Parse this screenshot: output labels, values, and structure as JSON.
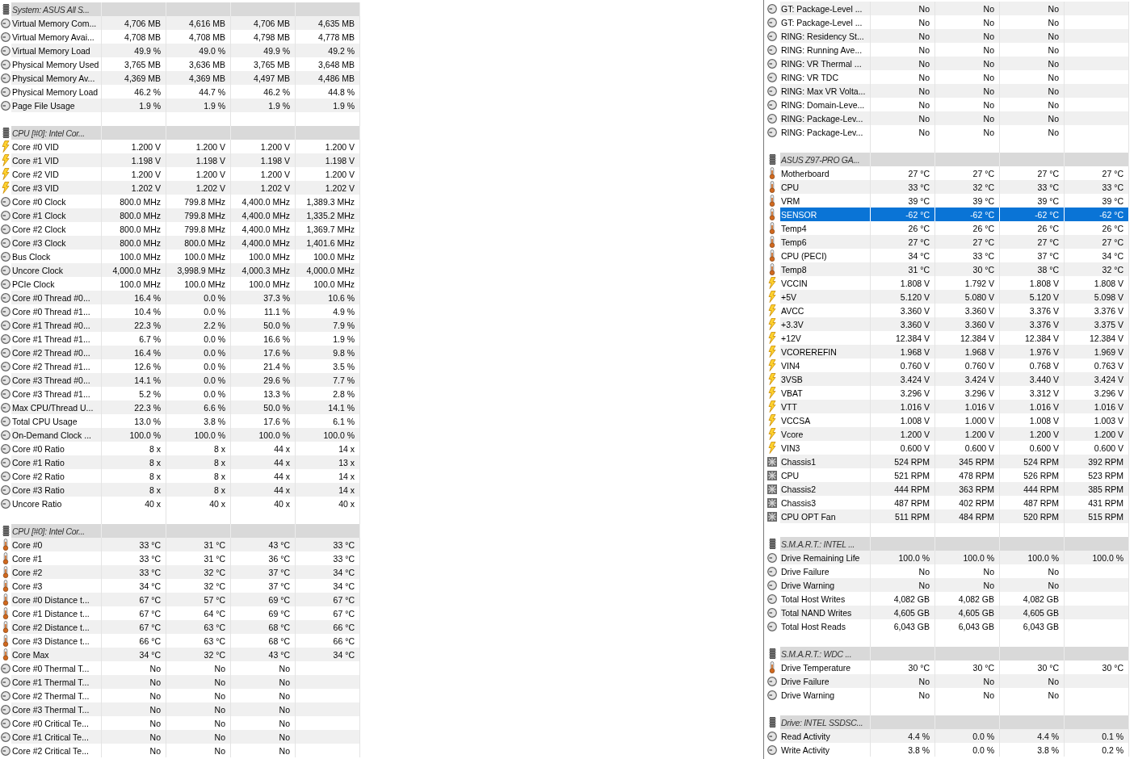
{
  "panels": [
    {
      "groups": [
        {
          "title": "System: ASUS All S...",
          "rows": [
            {
              "kind": "gauge",
              "name": "Virtual Memory Com...",
              "values": [
                "4,706 MB",
                "4,616 MB",
                "4,706 MB",
                "4,635 MB"
              ],
              "selected": false
            },
            {
              "kind": "gauge",
              "name": "Virtual Memory Avai...",
              "values": [
                "4,708 MB",
                "4,708 MB",
                "4,798 MB",
                "4,778 MB"
              ],
              "selected": false
            },
            {
              "kind": "gauge",
              "name": "Virtual Memory Load",
              "values": [
                "49.9 %",
                "49.0 %",
                "49.9 %",
                "49.2 %"
              ],
              "selected": false
            },
            {
              "kind": "gauge",
              "name": "Physical Memory Used",
              "values": [
                "3,765 MB",
                "3,636 MB",
                "3,765 MB",
                "3,648 MB"
              ],
              "selected": false
            },
            {
              "kind": "gauge",
              "name": "Physical Memory Av...",
              "values": [
                "4,369 MB",
                "4,369 MB",
                "4,497 MB",
                "4,486 MB"
              ],
              "selected": false
            },
            {
              "kind": "gauge",
              "name": "Physical Memory Load",
              "values": [
                "46.2 %",
                "44.7 %",
                "46.2 %",
                "44.8 %"
              ],
              "selected": false
            },
            {
              "kind": "gauge",
              "name": "Page File Usage",
              "values": [
                "1.9 %",
                "1.9 %",
                "1.9 %",
                "1.9 %"
              ],
              "selected": false
            }
          ]
        },
        {
          "title": "CPU [#0]: Intel Cor...",
          "rows": [
            {
              "kind": "voltage",
              "name": "Core #0 VID",
              "values": [
                "1.200 V",
                "1.200 V",
                "1.200 V",
                "1.200 V"
              ],
              "selected": false
            },
            {
              "kind": "voltage",
              "name": "Core #1 VID",
              "values": [
                "1.198 V",
                "1.198 V",
                "1.198 V",
                "1.198 V"
              ],
              "selected": false
            },
            {
              "kind": "voltage",
              "name": "Core #2 VID",
              "values": [
                "1.200 V",
                "1.200 V",
                "1.200 V",
                "1.200 V"
              ],
              "selected": false
            },
            {
              "kind": "voltage",
              "name": "Core #3 VID",
              "values": [
                "1.202 V",
                "1.202 V",
                "1.202 V",
                "1.202 V"
              ],
              "selected": false
            },
            {
              "kind": "gauge",
              "name": "Core #0 Clock",
              "values": [
                "800.0 MHz",
                "799.8 MHz",
                "4,400.0 MHz",
                "1,389.3 MHz"
              ],
              "selected": false
            },
            {
              "kind": "gauge",
              "name": "Core #1 Clock",
              "values": [
                "800.0 MHz",
                "799.8 MHz",
                "4,400.0 MHz",
                "1,335.2 MHz"
              ],
              "selected": false
            },
            {
              "kind": "gauge",
              "name": "Core #2 Clock",
              "values": [
                "800.0 MHz",
                "799.8 MHz",
                "4,400.0 MHz",
                "1,369.7 MHz"
              ],
              "selected": false
            },
            {
              "kind": "gauge",
              "name": "Core #3 Clock",
              "values": [
                "800.0 MHz",
                "800.0 MHz",
                "4,400.0 MHz",
                "1,401.6 MHz"
              ],
              "selected": false
            },
            {
              "kind": "gauge",
              "name": "Bus Clock",
              "values": [
                "100.0 MHz",
                "100.0 MHz",
                "100.0 MHz",
                "100.0 MHz"
              ],
              "selected": false
            },
            {
              "kind": "gauge",
              "name": "Uncore Clock",
              "values": [
                "4,000.0 MHz",
                "3,998.9 MHz",
                "4,000.3 MHz",
                "4,000.0 MHz"
              ],
              "selected": false
            },
            {
              "kind": "gauge",
              "name": "PCIe Clock",
              "values": [
                "100.0 MHz",
                "100.0 MHz",
                "100.0 MHz",
                "100.0 MHz"
              ],
              "selected": false
            },
            {
              "kind": "gauge",
              "name": "Core #0 Thread #0...",
              "values": [
                "16.4 %",
                "0.0 %",
                "37.3 %",
                "10.6 %"
              ],
              "selected": false
            },
            {
              "kind": "gauge",
              "name": "Core #0 Thread #1...",
              "values": [
                "10.4 %",
                "0.0 %",
                "11.1 %",
                "4.9 %"
              ],
              "selected": false
            },
            {
              "kind": "gauge",
              "name": "Core #1 Thread #0...",
              "values": [
                "22.3 %",
                "2.2 %",
                "50.0 %",
                "7.9 %"
              ],
              "selected": false
            },
            {
              "kind": "gauge",
              "name": "Core #1 Thread #1...",
              "values": [
                "6.7 %",
                "0.0 %",
                "16.6 %",
                "1.9 %"
              ],
              "selected": false
            },
            {
              "kind": "gauge",
              "name": "Core #2 Thread #0...",
              "values": [
                "16.4 %",
                "0.0 %",
                "17.6 %",
                "9.8 %"
              ],
              "selected": false
            },
            {
              "kind": "gauge",
              "name": "Core #2 Thread #1...",
              "values": [
                "12.6 %",
                "0.0 %",
                "21.4 %",
                "3.5 %"
              ],
              "selected": false
            },
            {
              "kind": "gauge",
              "name": "Core #3 Thread #0...",
              "values": [
                "14.1 %",
                "0.0 %",
                "29.6 %",
                "7.7 %"
              ],
              "selected": false
            },
            {
              "kind": "gauge",
              "name": "Core #3 Thread #1...",
              "values": [
                "5.2 %",
                "0.0 %",
                "13.3 %",
                "2.8 %"
              ],
              "selected": false
            },
            {
              "kind": "gauge",
              "name": "Max CPU/Thread U...",
              "values": [
                "22.3 %",
                "6.6 %",
                "50.0 %",
                "14.1 %"
              ],
              "selected": false
            },
            {
              "kind": "gauge",
              "name": "Total CPU Usage",
              "values": [
                "13.0 %",
                "3.8 %",
                "17.6 %",
                "6.1 %"
              ],
              "selected": false
            },
            {
              "kind": "gauge",
              "name": "On-Demand Clock ...",
              "values": [
                "100.0 %",
                "100.0 %",
                "100.0 %",
                "100.0 %"
              ],
              "selected": false
            },
            {
              "kind": "gauge",
              "name": "Core #0 Ratio",
              "values": [
                "8 x",
                "8 x",
                "44 x",
                "14 x"
              ],
              "selected": false
            },
            {
              "kind": "gauge",
              "name": "Core #1 Ratio",
              "values": [
                "8 x",
                "8 x",
                "44 x",
                "13 x"
              ],
              "selected": false
            },
            {
              "kind": "gauge",
              "name": "Core #2 Ratio",
              "values": [
                "8 x",
                "8 x",
                "44 x",
                "14 x"
              ],
              "selected": false
            },
            {
              "kind": "gauge",
              "name": "Core #3 Ratio",
              "values": [
                "8 x",
                "8 x",
                "44 x",
                "14 x"
              ],
              "selected": false
            },
            {
              "kind": "gauge",
              "name": "Uncore Ratio",
              "values": [
                "40 x",
                "40 x",
                "40 x",
                "40 x"
              ],
              "selected": false
            }
          ]
        },
        {
          "title": "CPU [#0]: Intel Cor...",
          "rows": [
            {
              "kind": "temperature",
              "name": "Core #0",
              "values": [
                "33 °C",
                "31 °C",
                "43 °C",
                "33 °C"
              ],
              "selected": false
            },
            {
              "kind": "temperature",
              "name": "Core #1",
              "values": [
                "33 °C",
                "31 °C",
                "36 °C",
                "33 °C"
              ],
              "selected": false
            },
            {
              "kind": "temperature",
              "name": "Core #2",
              "values": [
                "33 °C",
                "32 °C",
                "37 °C",
                "34 °C"
              ],
              "selected": false
            },
            {
              "kind": "temperature",
              "name": "Core #3",
              "values": [
                "34 °C",
                "32 °C",
                "37 °C",
                "34 °C"
              ],
              "selected": false
            },
            {
              "kind": "temperature",
              "name": "Core #0 Distance t...",
              "values": [
                "67 °C",
                "57 °C",
                "69 °C",
                "67 °C"
              ],
              "selected": false
            },
            {
              "kind": "temperature",
              "name": "Core #1 Distance t...",
              "values": [
                "67 °C",
                "64 °C",
                "69 °C",
                "67 °C"
              ],
              "selected": false
            },
            {
              "kind": "temperature",
              "name": "Core #2 Distance t...",
              "values": [
                "67 °C",
                "63 °C",
                "68 °C",
                "66 °C"
              ],
              "selected": false
            },
            {
              "kind": "temperature",
              "name": "Core #3 Distance t...",
              "values": [
                "66 °C",
                "63 °C",
                "68 °C",
                "66 °C"
              ],
              "selected": false
            },
            {
              "kind": "temperature",
              "name": "Core Max",
              "values": [
                "34 °C",
                "32 °C",
                "43 °C",
                "34 °C"
              ],
              "selected": false
            },
            {
              "kind": "gauge",
              "name": "Core #0 Thermal T...",
              "values": [
                "No",
                "No",
                "No"
              ],
              "selected": false
            },
            {
              "kind": "gauge",
              "name": "Core #1 Thermal T...",
              "values": [
                "No",
                "No",
                "No"
              ],
              "selected": false
            },
            {
              "kind": "gauge",
              "name": "Core #2 Thermal T...",
              "values": [
                "No",
                "No",
                "No"
              ],
              "selected": false
            },
            {
              "kind": "gauge",
              "name": "Core #3 Thermal T...",
              "values": [
                "No",
                "No",
                "No"
              ],
              "selected": false
            },
            {
              "kind": "gauge",
              "name": "Core #0 Critical Te...",
              "values": [
                "No",
                "No",
                "No"
              ],
              "selected": false
            },
            {
              "kind": "gauge",
              "name": "Core #1 Critical Te...",
              "values": [
                "No",
                "No",
                "No"
              ],
              "selected": false
            },
            {
              "kind": "gauge",
              "name": "Core #2 Critical Te...",
              "values": [
                "No",
                "No",
                "No"
              ],
              "selected": false
            }
          ]
        }
      ]
    },
    {
      "groups": [
        {
          "rows": [
            {
              "kind": "gauge",
              "name": "GT: Package-Level ...",
              "values": [
                "No",
                "No",
                "No"
              ],
              "selected": false
            },
            {
              "kind": "gauge",
              "name": "GT: Package-Level ...",
              "values": [
                "No",
                "No",
                "No"
              ],
              "selected": false
            },
            {
              "kind": "gauge",
              "name": "RING: Residency St...",
              "values": [
                "No",
                "No",
                "No"
              ],
              "selected": false
            },
            {
              "kind": "gauge",
              "name": "RING: Running Ave...",
              "values": [
                "No",
                "No",
                "No"
              ],
              "selected": false
            },
            {
              "kind": "gauge",
              "name": "RING: VR Thermal ...",
              "values": [
                "No",
                "No",
                "No"
              ],
              "selected": false
            },
            {
              "kind": "gauge",
              "name": "RING: VR TDC",
              "values": [
                "No",
                "No",
                "No"
              ],
              "selected": false
            },
            {
              "kind": "gauge",
              "name": "RING: Max VR Volta...",
              "values": [
                "No",
                "No",
                "No"
              ],
              "selected": false
            },
            {
              "kind": "gauge",
              "name": "RING: Domain-Leve...",
              "values": [
                "No",
                "No",
                "No"
              ],
              "selected": false
            },
            {
              "kind": "gauge",
              "name": "RING: Package-Lev...",
              "values": [
                "No",
                "No",
                "No"
              ],
              "selected": false
            },
            {
              "kind": "gauge",
              "name": "RING: Package-Lev...",
              "values": [
                "No",
                "No",
                "No"
              ],
              "selected": false
            }
          ]
        },
        {
          "title": "ASUS Z97-PRO GA...",
          "rows": [
            {
              "kind": "temperature",
              "name": "Motherboard",
              "values": [
                "27 °C",
                "27 °C",
                "27 °C",
                "27 °C"
              ],
              "selected": false
            },
            {
              "kind": "temperature",
              "name": "CPU",
              "values": [
                "33 °C",
                "32 °C",
                "33 °C",
                "33 °C"
              ],
              "selected": false
            },
            {
              "kind": "temperature",
              "name": "VRM",
              "values": [
                "39 °C",
                "39 °C",
                "39 °C",
                "39 °C"
              ],
              "selected": false
            },
            {
              "kind": "temperature",
              "name": "SENSOR",
              "values": [
                "-62 °C",
                "-62 °C",
                "-62 °C",
                "-62 °C"
              ],
              "selected": true
            },
            {
              "kind": "temperature",
              "name": "Temp4",
              "values": [
                "26 °C",
                "26 °C",
                "26 °C",
                "26 °C"
              ],
              "selected": false
            },
            {
              "kind": "temperature",
              "name": "Temp6",
              "values": [
                "27 °C",
                "27 °C",
                "27 °C",
                "27 °C"
              ],
              "selected": false
            },
            {
              "kind": "temperature",
              "name": "CPU (PECI)",
              "values": [
                "34 °C",
                "33 °C",
                "37 °C",
                "34 °C"
              ],
              "selected": false
            },
            {
              "kind": "temperature",
              "name": "Temp8",
              "values": [
                "31 °C",
                "30 °C",
                "38 °C",
                "32 °C"
              ],
              "selected": false
            },
            {
              "kind": "voltage",
              "name": "VCCIN",
              "values": [
                "1.808 V",
                "1.792 V",
                "1.808 V",
                "1.808 V"
              ],
              "selected": false
            },
            {
              "kind": "voltage",
              "name": "+5V",
              "values": [
                "5.120 V",
                "5.080 V",
                "5.120 V",
                "5.098 V"
              ],
              "selected": false
            },
            {
              "kind": "voltage",
              "name": "AVCC",
              "values": [
                "3.360 V",
                "3.360 V",
                "3.376 V",
                "3.376 V"
              ],
              "selected": false
            },
            {
              "kind": "voltage",
              "name": "+3.3V",
              "values": [
                "3.360 V",
                "3.360 V",
                "3.376 V",
                "3.375 V"
              ],
              "selected": false
            },
            {
              "kind": "voltage",
              "name": "+12V",
              "values": [
                "12.384 V",
                "12.384 V",
                "12.384 V",
                "12.384 V"
              ],
              "selected": false
            },
            {
              "kind": "voltage",
              "name": "VCOREREFIN",
              "values": [
                "1.968 V",
                "1.968 V",
                "1.976 V",
                "1.969 V"
              ],
              "selected": false
            },
            {
              "kind": "voltage",
              "name": "VIN4",
              "values": [
                "0.760 V",
                "0.760 V",
                "0.768 V",
                "0.763 V"
              ],
              "selected": false
            },
            {
              "kind": "voltage",
              "name": "3VSB",
              "values": [
                "3.424 V",
                "3.424 V",
                "3.440 V",
                "3.424 V"
              ],
              "selected": false
            },
            {
              "kind": "voltage",
              "name": "VBAT",
              "values": [
                "3.296 V",
                "3.296 V",
                "3.312 V",
                "3.296 V"
              ],
              "selected": false
            },
            {
              "kind": "voltage",
              "name": "VTT",
              "values": [
                "1.016 V",
                "1.016 V",
                "1.016 V",
                "1.016 V"
              ],
              "selected": false
            },
            {
              "kind": "voltage",
              "name": "VCCSA",
              "values": [
                "1.008 V",
                "1.000 V",
                "1.008 V",
                "1.003 V"
              ],
              "selected": false
            },
            {
              "kind": "voltage",
              "name": "Vcore",
              "values": [
                "1.200 V",
                "1.200 V",
                "1.200 V",
                "1.200 V"
              ],
              "selected": false
            },
            {
              "kind": "voltage",
              "name": "VIN3",
              "values": [
                "0.600 V",
                "0.600 V",
                "0.600 V",
                "0.600 V"
              ],
              "selected": false
            },
            {
              "kind": "fan",
              "name": "Chassis1",
              "values": [
                "524 RPM",
                "345 RPM",
                "524 RPM",
                "392 RPM"
              ],
              "selected": false
            },
            {
              "kind": "fan",
              "name": "CPU",
              "values": [
                "521 RPM",
                "478 RPM",
                "526 RPM",
                "523 RPM"
              ],
              "selected": false
            },
            {
              "kind": "fan",
              "name": "Chassis2",
              "values": [
                "444 RPM",
                "363 RPM",
                "444 RPM",
                "385 RPM"
              ],
              "selected": false
            },
            {
              "kind": "fan",
              "name": "Chassis3",
              "values": [
                "487 RPM",
                "402 RPM",
                "487 RPM",
                "431 RPM"
              ],
              "selected": false
            },
            {
              "kind": "fan",
              "name": "CPU OPT Fan",
              "values": [
                "511 RPM",
                "484 RPM",
                "520 RPM",
                "515 RPM"
              ],
              "selected": false
            }
          ]
        },
        {
          "title": "S.M.A.R.T.: INTEL ...",
          "rows": [
            {
              "kind": "gauge",
              "name": "Drive Remaining Life",
              "values": [
                "100.0 %",
                "100.0 %",
                "100.0 %",
                "100.0 %"
              ],
              "selected": false
            },
            {
              "kind": "gauge",
              "name": "Drive Failure",
              "values": [
                "No",
                "No",
                "No"
              ],
              "selected": false
            },
            {
              "kind": "gauge",
              "name": "Drive Warning",
              "values": [
                "No",
                "No",
                "No"
              ],
              "selected": false
            },
            {
              "kind": "gauge",
              "name": "Total Host Writes",
              "values": [
                "4,082 GB",
                "4,082 GB",
                "4,082 GB"
              ],
              "selected": false
            },
            {
              "kind": "gauge",
              "name": "Total NAND Writes",
              "values": [
                "4,605 GB",
                "4,605 GB",
                "4,605 GB"
              ],
              "selected": false
            },
            {
              "kind": "gauge",
              "name": "Total Host Reads",
              "values": [
                "6,043 GB",
                "6,043 GB",
                "6,043 GB"
              ],
              "selected": false
            }
          ]
        },
        {
          "title": "S.M.A.R.T.: WDC ...",
          "rows": [
            {
              "kind": "temperature",
              "name": "Drive Temperature",
              "values": [
                "30 °C",
                "30 °C",
                "30 °C",
                "30 °C"
              ],
              "selected": false
            },
            {
              "kind": "gauge",
              "name": "Drive Failure",
              "values": [
                "No",
                "No",
                "No"
              ],
              "selected": false
            },
            {
              "kind": "gauge",
              "name": "Drive Warning",
              "values": [
                "No",
                "No",
                "No"
              ],
              "selected": false
            }
          ]
        },
        {
          "title": "Drive: INTEL SSDSC...",
          "rows": [
            {
              "kind": "gauge",
              "name": "Read Activity",
              "values": [
                "4.4 %",
                "0.0 %",
                "4.4 %",
                "0.1 %"
              ],
              "selected": false
            },
            {
              "kind": "gauge",
              "name": "Write Activity",
              "values": [
                "3.8 %",
                "0.0 %",
                "3.8 %",
                "0.2 %"
              ],
              "selected": false
            }
          ]
        }
      ]
    }
  ]
}
